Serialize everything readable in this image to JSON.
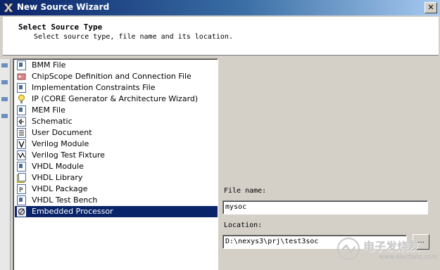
{
  "window": {
    "title": "New Source Wizard",
    "close_label": "✕"
  },
  "header": {
    "title": "Select Source Type",
    "subtitle": "Select source type, file name and its location."
  },
  "source_types": {
    "items": [
      {
        "label": "BMM File",
        "icon": "document-icon"
      },
      {
        "label": "ChipScope Definition and Connection File",
        "icon": "chipscope-icon"
      },
      {
        "label": "Implementation Constraints File",
        "icon": "document-icon"
      },
      {
        "label": "IP (CORE Generator & Architecture Wizard)",
        "icon": "bulb-icon"
      },
      {
        "label": "MEM File",
        "icon": "document-icon"
      },
      {
        "label": "Schematic",
        "icon": "schematic-icon"
      },
      {
        "label": "User Document",
        "icon": "text-document-icon"
      },
      {
        "label": "Verilog Module",
        "icon": "verilog-icon"
      },
      {
        "label": "Verilog Test Fixture",
        "icon": "verilog-test-icon"
      },
      {
        "label": "VHDL Module",
        "icon": "document-icon"
      },
      {
        "label": "VHDL Library",
        "icon": "library-icon"
      },
      {
        "label": "VHDL Package",
        "icon": "package-icon"
      },
      {
        "label": "VHDL Test Bench",
        "icon": "document-icon"
      },
      {
        "label": "Embedded Processor",
        "icon": "processor-icon"
      }
    ],
    "selected": "Embedded Processor"
  },
  "file_name": {
    "label": "File name:",
    "value": "mysoc"
  },
  "location": {
    "label": "Location:",
    "value": "D:\\nexys3\\prj\\test3soc",
    "browse_label": "..."
  },
  "watermark": {
    "text": "电子发烧友",
    "url": "www.elecfans.com"
  }
}
